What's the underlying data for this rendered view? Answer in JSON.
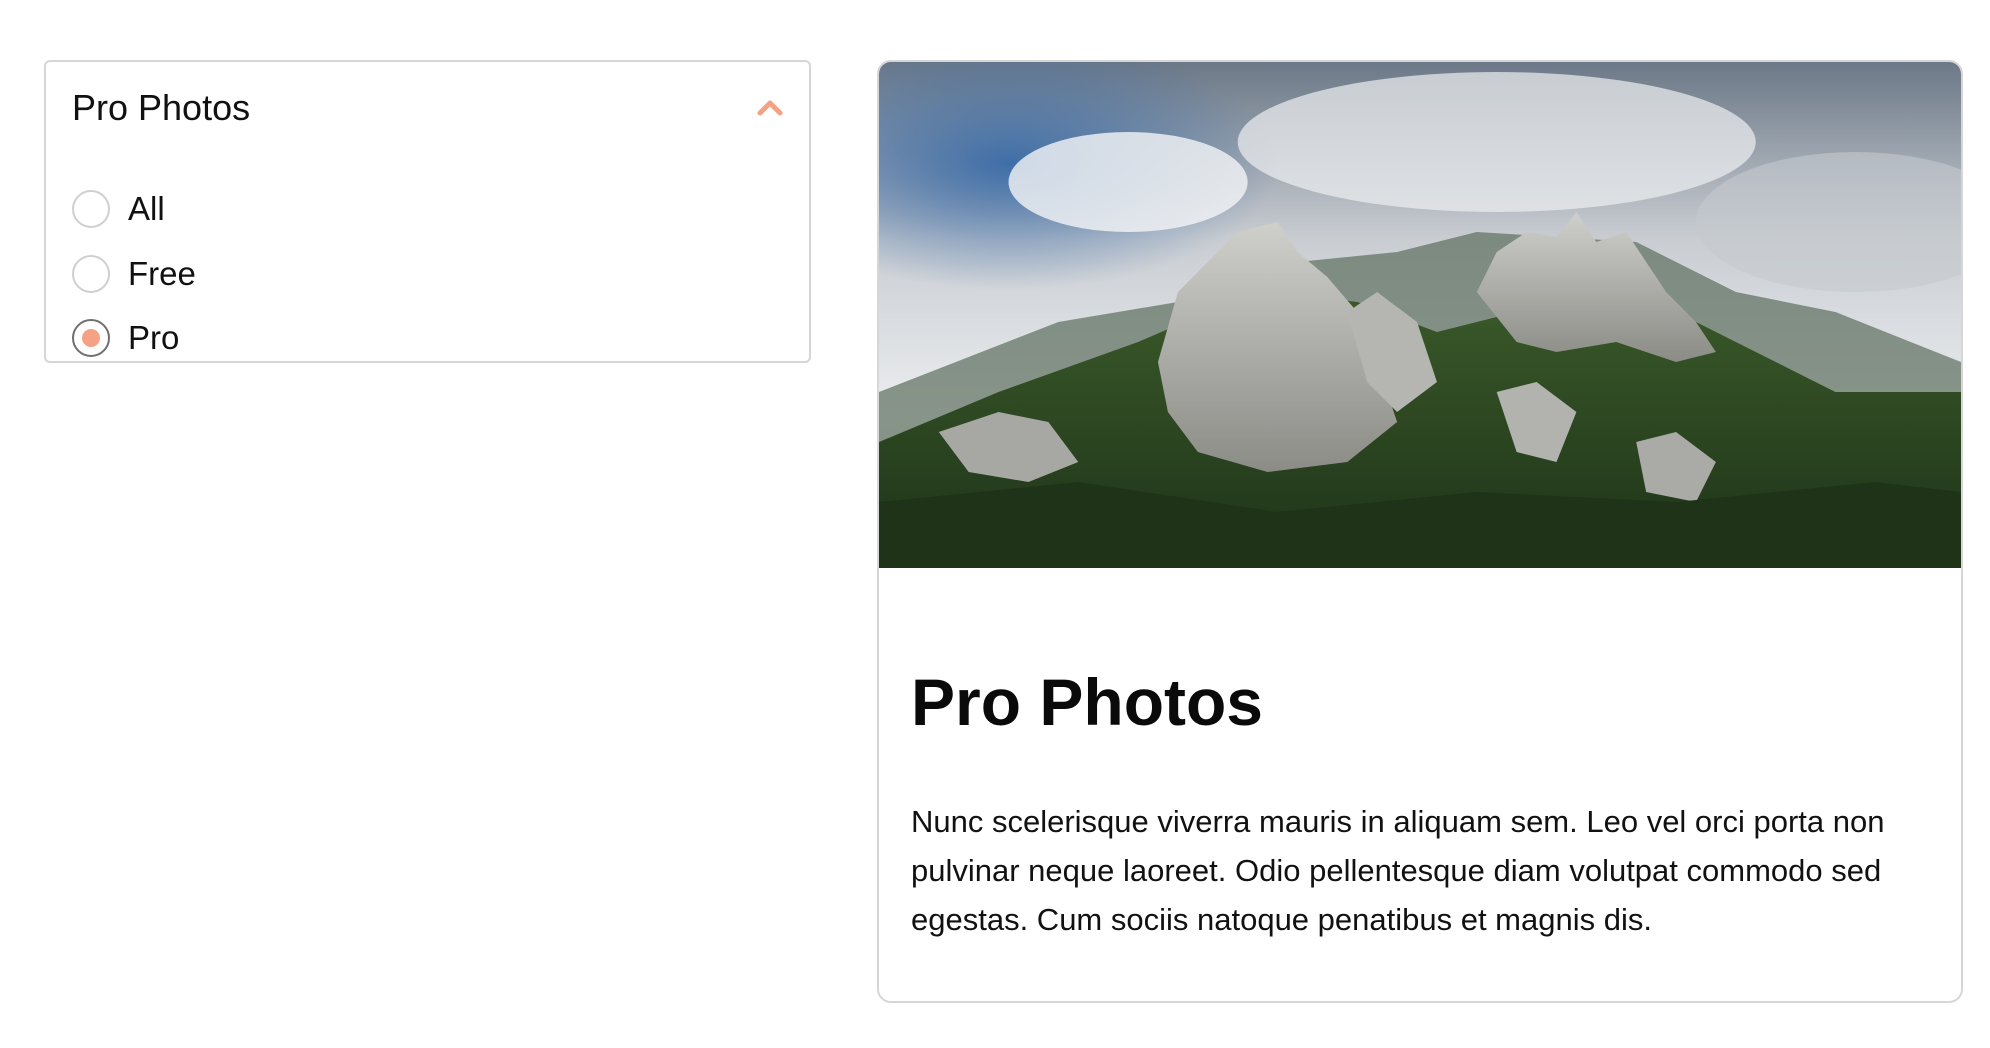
{
  "accent_color": "#f4a283",
  "filter": {
    "title": "Pro Photos",
    "toggle_icon": "chevron-up-icon",
    "expanded": true,
    "options": [
      {
        "label": "All",
        "checked": false
      },
      {
        "label": "Free",
        "checked": false
      },
      {
        "label": "Pro",
        "checked": true
      }
    ]
  },
  "card": {
    "image_subject": "mountain-landscape",
    "title": "Pro Photos",
    "body": "Nunc scelerisque viverra mauris in aliquam sem. Leo vel orci porta non pulvinar neque laoreet. Odio pellentesque diam volutpat commodo sed egestas. Cum sociis natoque penatibus et magnis dis."
  }
}
